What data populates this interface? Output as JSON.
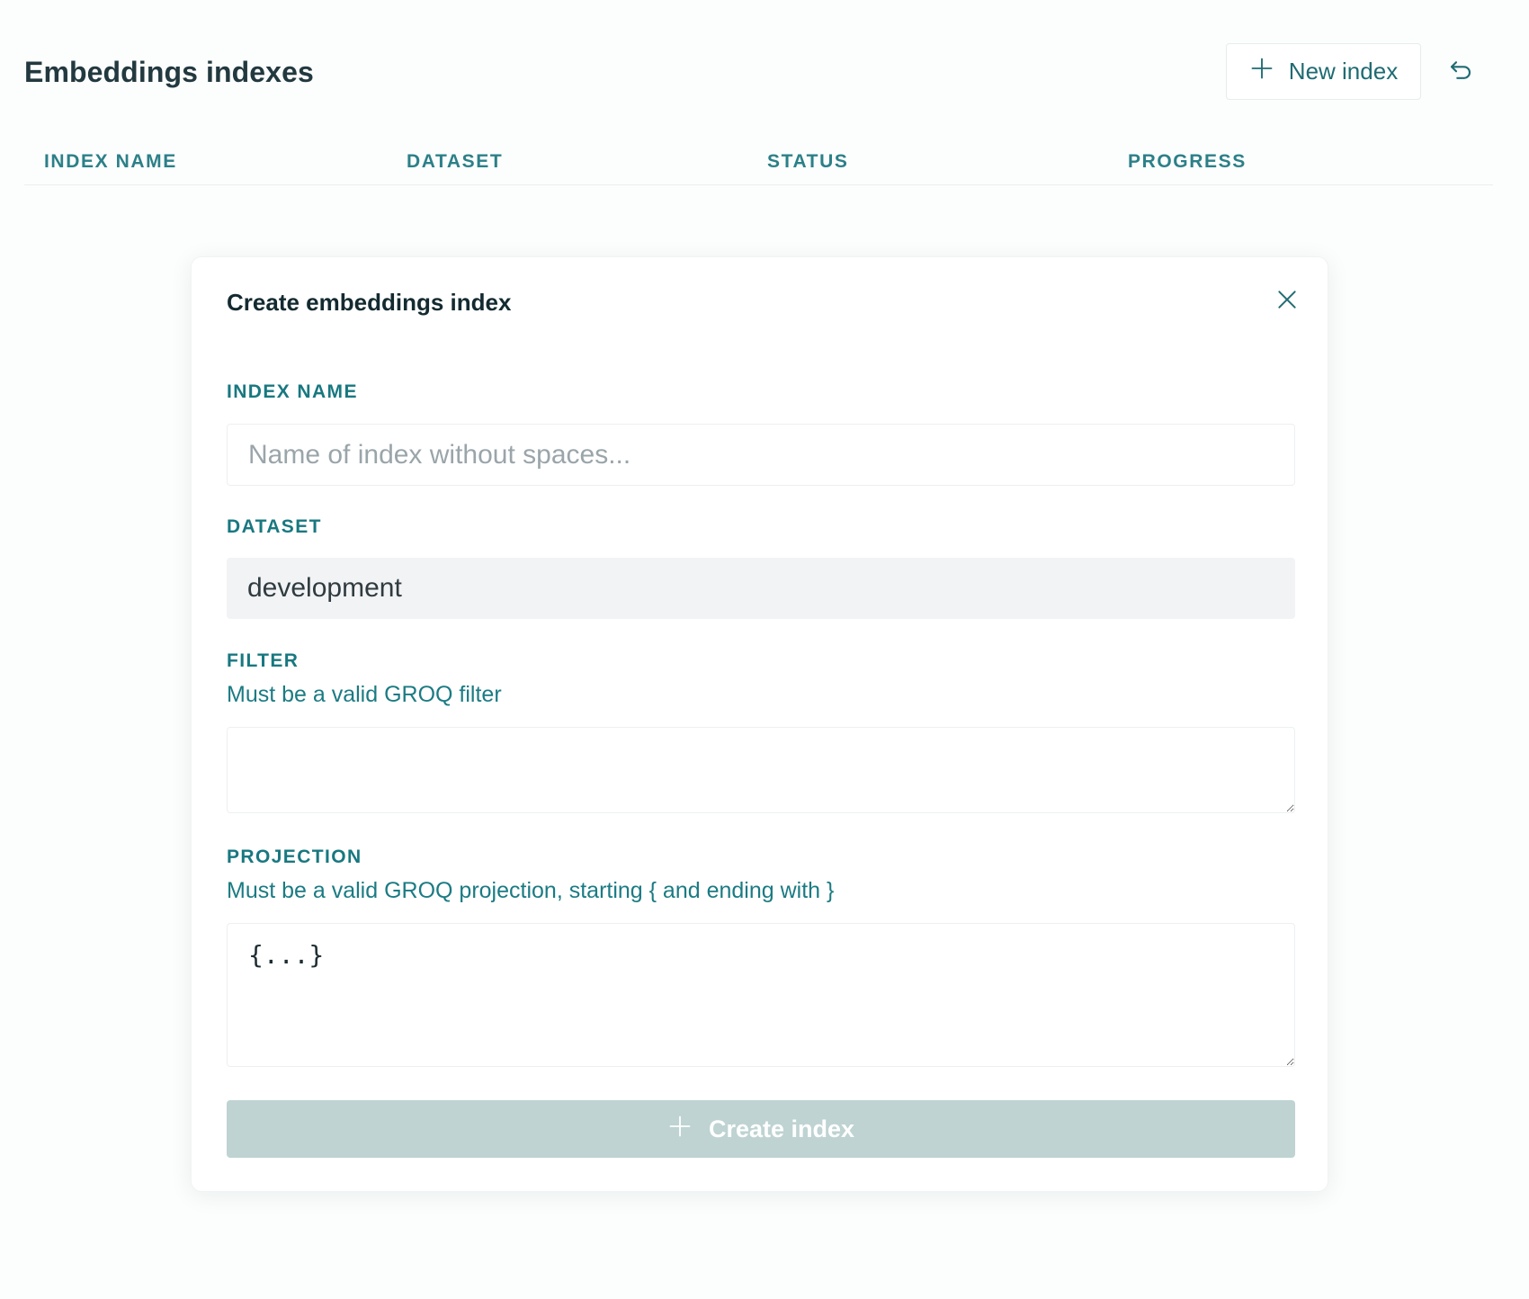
{
  "header": {
    "title": "Embeddings indexes",
    "new_index_label": "New index"
  },
  "table": {
    "columns": [
      "INDEX NAME",
      "DATASET",
      "STATUS",
      "PROGRESS"
    ]
  },
  "modal": {
    "title": "Create embeddings index",
    "index_name": {
      "label": "INDEX NAME",
      "placeholder": "Name of index without spaces...",
      "value": ""
    },
    "dataset": {
      "label": "DATASET",
      "selected": "development"
    },
    "filter": {
      "label": "FILTER",
      "hint": "Must be a valid GROQ filter",
      "value": ""
    },
    "projection": {
      "label": "PROJECTION",
      "hint": "Must be a valid GROQ projection, starting { and ending with }",
      "value": "{...}"
    },
    "create_label": "Create index"
  },
  "icons": {
    "new_index": "plus-icon",
    "refresh": "undo-arrow-icon",
    "close": "close-icon",
    "create": "plus-icon"
  },
  "colors": {
    "accent": "#1f6b73",
    "label": "#187880",
    "disabled_button": "#bed3d2"
  }
}
